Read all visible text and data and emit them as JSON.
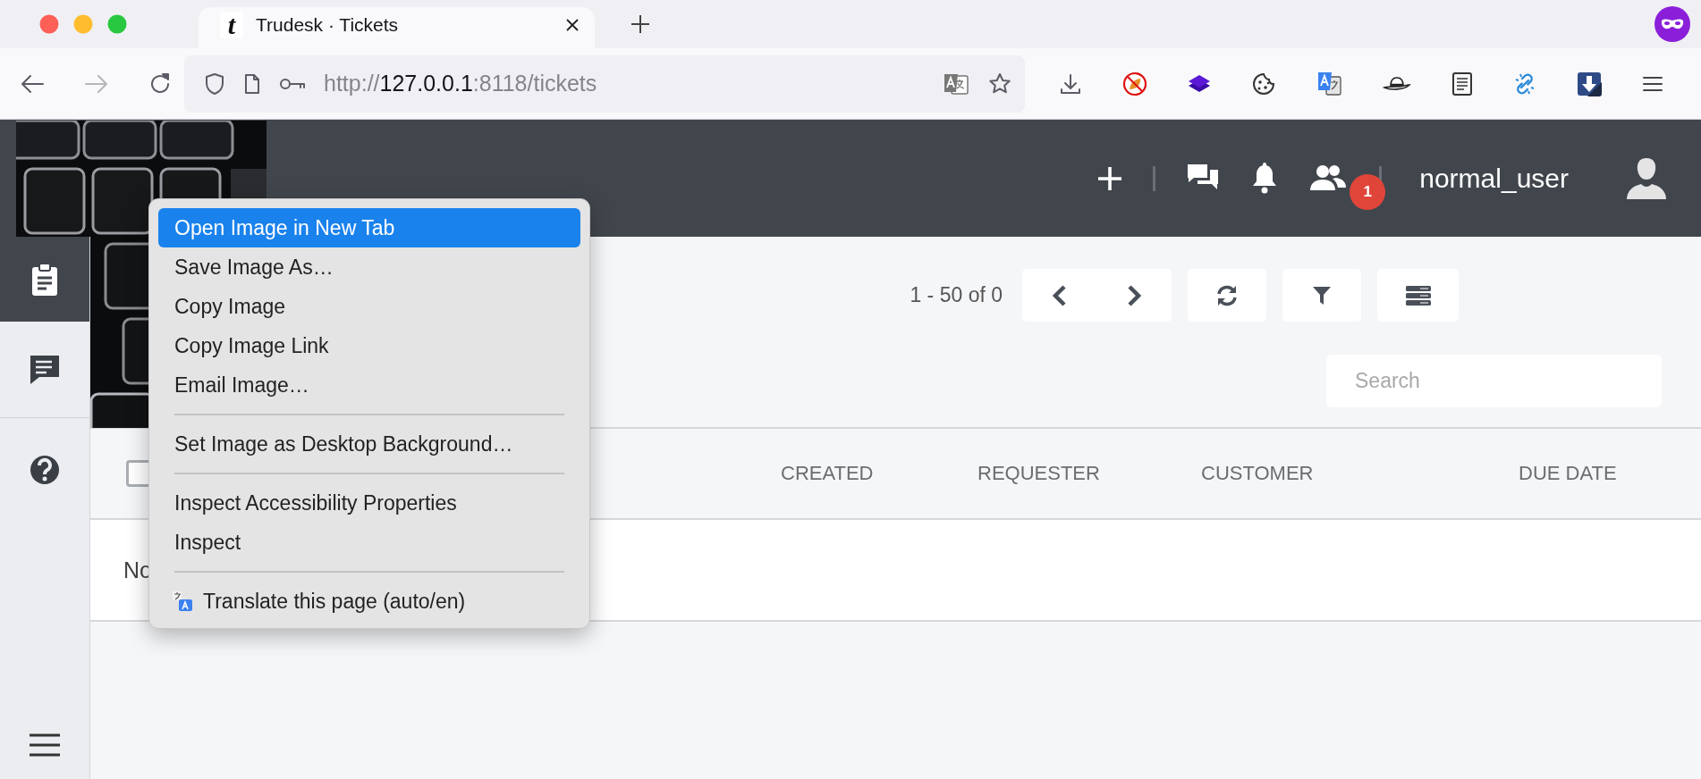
{
  "browser": {
    "tabs": [
      {
        "favicon": "t",
        "title": "Trudesk · Tickets"
      }
    ],
    "url": {
      "scheme": "http://",
      "host": "127.0.0.1",
      "rest": ":8118/tickets"
    }
  },
  "header": {
    "username": "normal_user",
    "badge": "1"
  },
  "sidebar": {
    "items": [
      {
        "kind": "tickets",
        "selected": true
      },
      {
        "kind": "messages",
        "selected": false
      },
      {
        "kind": "help",
        "selected": false
      }
    ]
  },
  "toolbar": {
    "pagination": "1 - 50 of 0"
  },
  "search": {
    "placeholder": "Search"
  },
  "table": {
    "select_all_checked": false,
    "columns": [
      "CREATED",
      "REQUESTER",
      "CUSTOMER",
      "DUE DATE"
    ],
    "empty_message": "No"
  },
  "context_menu": {
    "items": [
      {
        "kind": "item",
        "label": "Open Image in New Tab",
        "selected": true
      },
      {
        "kind": "item",
        "label": "Save Image As…",
        "selected": false
      },
      {
        "kind": "item",
        "label": "Copy Image",
        "selected": false
      },
      {
        "kind": "item",
        "label": "Copy Image Link",
        "selected": false
      },
      {
        "kind": "item",
        "label": "Email Image…",
        "selected": false
      },
      {
        "kind": "separator"
      },
      {
        "kind": "item",
        "label": "Set Image as Desktop Background…",
        "selected": false
      },
      {
        "kind": "separator"
      },
      {
        "kind": "item",
        "label": "Inspect Accessibility Properties",
        "selected": false
      },
      {
        "kind": "item",
        "label": "Inspect",
        "selected": false
      },
      {
        "kind": "separator"
      },
      {
        "kind": "translate",
        "label": "Translate this page (auto/en)",
        "selected": false
      }
    ]
  }
}
